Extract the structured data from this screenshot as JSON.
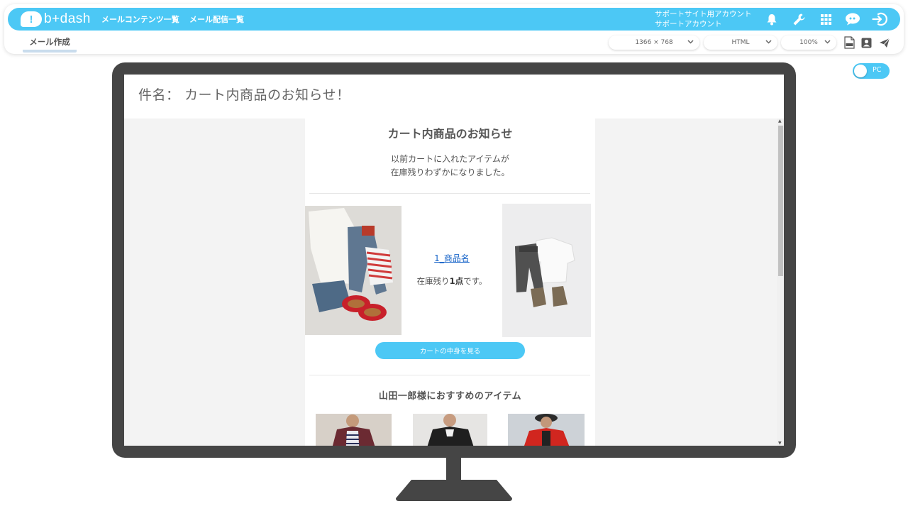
{
  "app": {
    "logo_text": "b+dash"
  },
  "header": {
    "nav": [
      "メールコンテンツ一覧",
      "メール配信一覧"
    ],
    "account_line1": "サポートサイト用アカウント",
    "account_line2": "サポートアカウント",
    "icons": [
      "bell-icon",
      "wrench-icon",
      "grid-icon",
      "chat-bubble-icon",
      "logout-icon"
    ]
  },
  "subbar": {
    "active_tab": "メール作成",
    "resolution": "1366 × 768",
    "format": "HTML",
    "zoom": "100%",
    "icons": [
      "html-file-icon",
      "contact-card-icon",
      "send-icon"
    ]
  },
  "preview_toggle": {
    "label": "PC"
  },
  "email": {
    "subject": "件名： カート内商品のお知らせ！",
    "title": "カート内商品のお知らせ",
    "intro_line1": "以前カートに入れたアイテムが",
    "intro_line2": "在庫残りわずかになりました。",
    "product_name": "1_商品名",
    "stock_prefix": "在庫残り",
    "stock_count": "1点",
    "stock_suffix": "です。",
    "cart_button": "カートの中身を見る",
    "recommend_title": "山田一郎様におすすめのアイテム"
  },
  "colors": {
    "accent": "#4cc8f5",
    "monitor": "#454545",
    "link": "#1a66c9"
  }
}
